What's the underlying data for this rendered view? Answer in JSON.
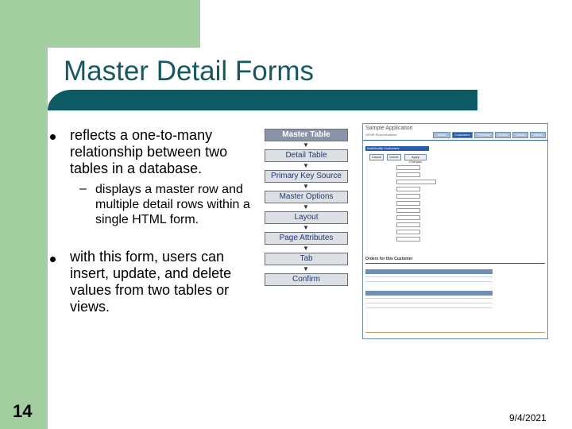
{
  "slide": {
    "title": "Master Detail Forms",
    "bullets": [
      {
        "text": "reflects a one-to-many relationship between two tables in a database.",
        "sub": "displays a master row and multiple detail rows within a single HTML form."
      },
      {
        "text": "with this form, users can insert, update, and delete values from two tables or views."
      }
    ],
    "slide_number": "14",
    "date": "9/4/2021"
  },
  "flow": {
    "steps": [
      "Master Table",
      "Detail Table",
      "Primary Key Source",
      "Master Options",
      "Layout",
      "Page Attributes",
      "Tab",
      "Confirm"
    ]
  },
  "thumbnail": {
    "app_name": "Sample Application",
    "user": "OEHR Representative",
    "tabs": [
      "Home",
      "Customers",
      "Products",
      "Orders",
      "Charts",
      "Admin"
    ],
    "section": "Add/Modify Customers",
    "buttons": [
      "Cancel",
      "Delete",
      "Apply Changes"
    ],
    "orders_title": "Orders for this Customer"
  }
}
